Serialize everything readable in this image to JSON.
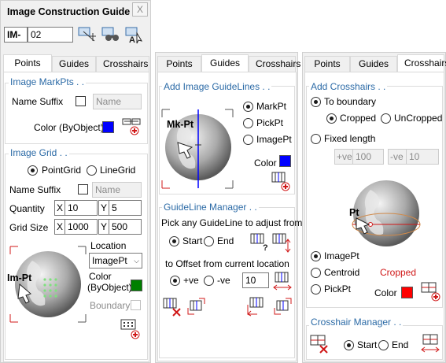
{
  "window": {
    "title": "Image Construction Guide . .",
    "close_label": "X",
    "im_label": "IM-",
    "im_value": "02"
  },
  "panel1": {
    "tabs": [
      "Points",
      "Guides",
      "Crosshairs"
    ],
    "markpts": {
      "title": "Image MarkPts . .",
      "name_suffix_label": "Name Suffix",
      "name_placeholder": "Name",
      "color_label": "Color (ByObject)",
      "color": "#0000ff"
    },
    "grid": {
      "title": "Image Grid . .",
      "pointgrid_label": "PointGrid",
      "linegrid_label": "LineGrid",
      "name_suffix_label": "Name Suffix",
      "name_placeholder": "Name",
      "quantity_label": "Quantity",
      "x_label": "X",
      "y_label": "Y",
      "quantity_x": "10",
      "quantity_y": "5",
      "grid_size_label": "Grid Size",
      "grid_size_x": "1000",
      "grid_size_y": "500",
      "location_label": "Location",
      "location_value": "ImagePt",
      "color_label_1": "Color",
      "color_label_2": "(ByObject)",
      "color": "#008000",
      "boundary_label": "Boundary",
      "globe_label": "Im-Pt"
    }
  },
  "panel2": {
    "tabs": [
      "Points",
      "Guides",
      "Crosshairs"
    ],
    "add": {
      "title": "Add Image GuideLines . .",
      "globe_label": "Mk-Pt",
      "markpt_label": "MarkPt",
      "pickpt_label": "PickPt",
      "imagept_label": "ImagePt",
      "color_label": "Color",
      "color": "#0000ff"
    },
    "manager": {
      "title": "GuideLine Manager . .",
      "instruction": "Pick any GuideLine to adjust from",
      "start_label": "Start",
      "end_label": "End",
      "offset_label": "to Offset from current location",
      "plus_label": "+ve",
      "minus_label": "-ve",
      "offset_value": "10"
    }
  },
  "panel3": {
    "tabs": [
      "Points",
      "Guides",
      "Crosshairs"
    ],
    "add": {
      "title": "Add Crosshairs . .",
      "to_boundary_label": "To boundary",
      "cropped_label": "Cropped",
      "uncropped_label": "UnCropped",
      "fixed_length_label": "Fixed length",
      "plus_label": "+ve",
      "plus_value": "100",
      "minus_label": "-ve",
      "minus_value": "10",
      "globe_label": "Pt",
      "imagept_label": "ImagePt",
      "centroid_label": "Centroid",
      "pickpt_label": "PickPt",
      "cropped_status": "Cropped",
      "color_label": "Color",
      "color": "#ff0000"
    },
    "manager": {
      "title": "Crosshair Manager . .",
      "start_label": "Start",
      "end_label": "End"
    }
  }
}
